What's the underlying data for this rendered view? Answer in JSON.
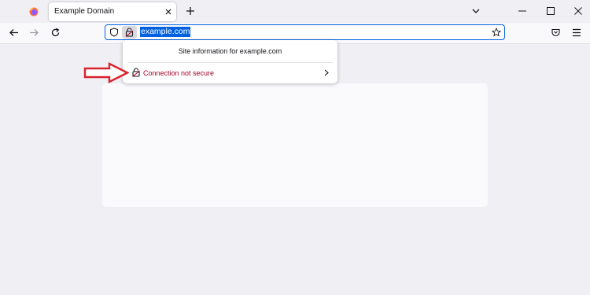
{
  "tab": {
    "title": "Example Domain"
  },
  "urlbar": {
    "url": "example.com"
  },
  "popup": {
    "title": "Site information for example.com",
    "connection_label": "Connection not secure"
  },
  "colors": {
    "accent": "#0061e0",
    "insecure": "#a4002a",
    "annotation_arrow": "#d9232d"
  },
  "icons": [
    "firefox-logo-icon",
    "close-icon",
    "plus-icon",
    "chevron-down-icon",
    "minimize-icon",
    "maximize-icon",
    "window-close-icon",
    "back-arrow-icon",
    "forward-arrow-icon",
    "reload-icon",
    "shield-icon",
    "broken-lock-icon",
    "star-icon",
    "pocket-icon",
    "hamburger-menu-icon",
    "chevron-right-icon",
    "red-arrow-icon"
  ]
}
